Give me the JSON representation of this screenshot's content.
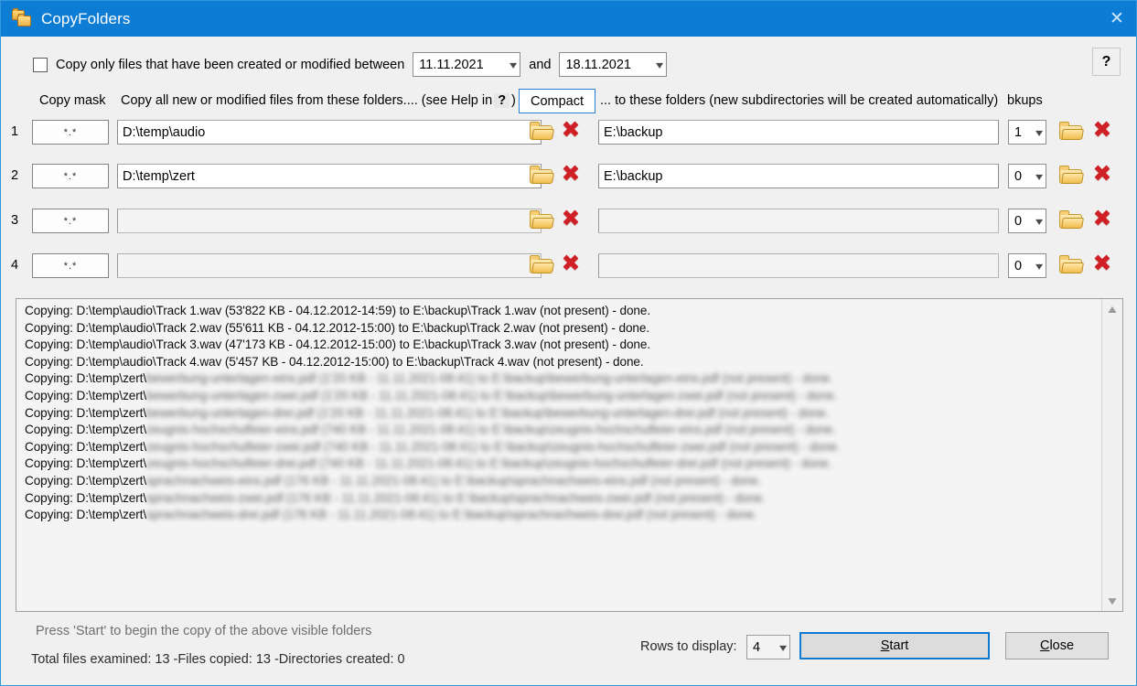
{
  "window": {
    "title": "CopyFolders",
    "app_icon": "folders-icon",
    "close_icon": "close-icon"
  },
  "filter": {
    "checkbox_checked": false,
    "label": "Copy only files that have been created or modified between",
    "date_from": "11.11.2021",
    "and_label": "and",
    "date_to": "18.11.2021",
    "help_button": "?"
  },
  "headers": {
    "copy_mask": "Copy mask",
    "from_folders_pre": "Copy all new or modified files from these folders.... (see Help in",
    "from_folders_q": "?",
    "from_folders_post": ")",
    "compact_button": "Compact",
    "to_folders": "... to these folders (new subdirectories will be created automatically)",
    "bkups": "bkups"
  },
  "rows": [
    {
      "num": "1",
      "mask": "*.*",
      "source": "D:\\temp\\audio",
      "destination": "E:\\backup",
      "bkups": "1"
    },
    {
      "num": "2",
      "mask": "*.*",
      "source": "D:\\temp\\zert",
      "destination": "E:\\backup",
      "bkups": "0"
    },
    {
      "num": "3",
      "mask": "*.*",
      "source": "",
      "destination": "",
      "bkups": "0"
    },
    {
      "num": "4",
      "mask": "*.*",
      "source": "",
      "destination": "",
      "bkups": "0"
    }
  ],
  "log": {
    "lines": [
      {
        "text": "Copying: D:\\temp\\audio\\Track 1.wav (53'822 KB - 04.12.2012-14:59)  to  E:\\backup\\Track 1.wav (not present)   - done.",
        "redacted": false
      },
      {
        "text": "Copying: D:\\temp\\audio\\Track 2.wav (55'611 KB - 04.12.2012-15:00)  to  E:\\backup\\Track 2.wav (not present)   - done.",
        "redacted": false
      },
      {
        "text": "Copying: D:\\temp\\audio\\Track 3.wav (47'173 KB - 04.12.2012-15:00)  to  E:\\backup\\Track 3.wav (not present)   - done.",
        "redacted": false
      },
      {
        "text": "Copying: D:\\temp\\audio\\Track 4.wav (5'457 KB - 04.12.2012-15:00)  to  E:\\backup\\Track 4.wav (not present)   - done.",
        "redacted": false
      },
      {
        "prefix": "Copying: D:\\temp\\zert\\",
        "blurred": "bewerbung-unterlagen-eins.pdf (1'20 KB - 11.11.2021-08:41)  to  E:\\backup\\bewerbung-unterlagen-eins.pdf (not present)   - done.",
        "redacted": true
      },
      {
        "prefix": "Copying: D:\\temp\\zert\\",
        "blurred": "bewerbung-unterlagen-zwei.pdf (1'20 KB - 11.11.2021-08:41)  to  E:\\backup\\bewerbung-unterlagen-zwei.pdf (not present)   - done.",
        "redacted": true
      },
      {
        "prefix": "Copying: D:\\temp\\zert\\",
        "blurred": "bewerbung-unterlagen-drei.pdf (1'20 KB - 11.11.2021-08:41)  to  E:\\backup\\bewerbung-unterlagen-drei.pdf (not present)   - done.",
        "redacted": true
      },
      {
        "prefix": "Copying: D:\\temp\\zert\\",
        "blurred": "zeugnis-hochschulfeier-eins.pdf (740 KB - 11.11.2021-08:41)  to  E:\\backup\\zeugnis-hochschulfeier-eins.pdf (not present)   - done.",
        "redacted": true
      },
      {
        "prefix": "Copying: D:\\temp\\zert\\",
        "blurred": "zeugnis-hochschulfeier-zwei.pdf (740 KB - 11.11.2021-08:41)  to  E:\\backup\\zeugnis-hochschulfeier-zwei.pdf (not present)   - done.",
        "redacted": true
      },
      {
        "prefix": "Copying: D:\\temp\\zert\\",
        "blurred": "zeugnis-hochschulfeier-drei.pdf (740 KB - 11.11.2021-08:41)  to  E:\\backup\\zeugnis-hochschulfeier-drei.pdf (not present)   - done.",
        "redacted": true
      },
      {
        "prefix": "Copying: D:\\temp\\zert\\",
        "blurred": "sprachnachweis-eins.pdf (176 KB - 11.11.2021-08:41)  to  E:\\backup\\sprachnachweis-eins.pdf (not present)    - done.",
        "redacted": true
      },
      {
        "prefix": "Copying: D:\\temp\\zert\\",
        "blurred": "sprachnachweis-zwei.pdf (176 KB - 11.11.2021-08:41)  to  E:\\backup\\sprachnachweis-zwei.pdf (not present)    - done.",
        "redacted": true
      },
      {
        "prefix": "Copying: D:\\temp\\zert\\",
        "blurred": "sprachnachweis-drei.pdf (176 KB - 11.11.2021-08:41)  to  E:\\backup\\sprachnachweis-drei.pdf (not present)    - done.",
        "redacted": true
      }
    ],
    "scroll_up_icon": "chevron-up-icon",
    "scroll_down_icon": "chevron-down-icon"
  },
  "footer": {
    "hint": "Press 'Start' to begin the copy of the above visible folders",
    "summary": "Total files examined: 13  -Files copied: 13  -Directories created: 0",
    "rows_to_display_label": "Rows to display:",
    "rows_to_display_value": "4",
    "start_accel": "S",
    "start_rest": "tart",
    "close_accel": "C",
    "close_rest": "lose"
  },
  "colors": {
    "titlebar": "#0d7cd5",
    "accent": "#0f7ad2",
    "surface": "#f0f0f0",
    "delete_icon": "#cf2026",
    "folder_icon": "#f3c55f"
  }
}
